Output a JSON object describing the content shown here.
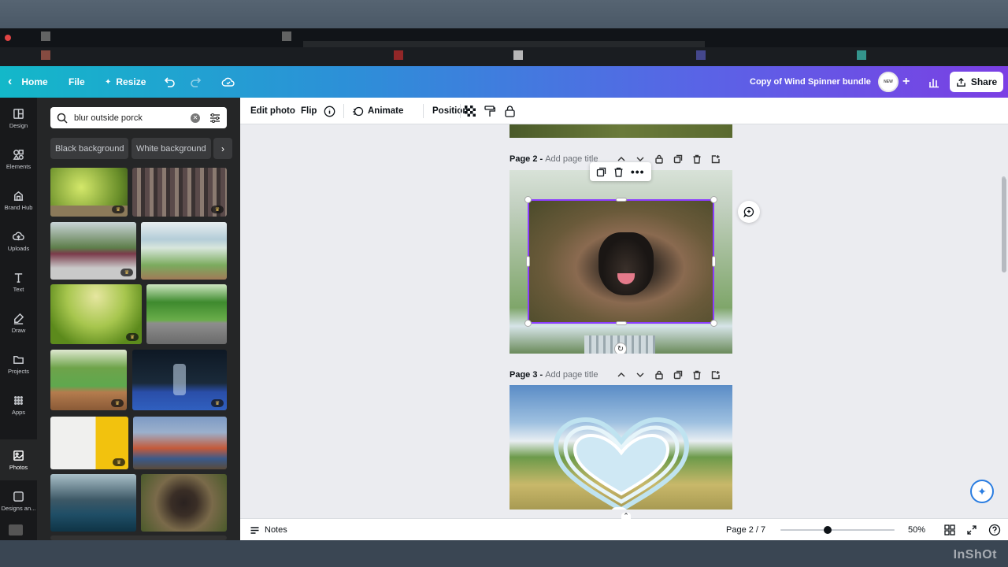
{
  "topbar": {
    "home": "Home",
    "file": "File",
    "resize": "Resize",
    "doc_title": "Copy of Wind Spinner bundle",
    "share": "Share"
  },
  "rail": [
    {
      "label": "Design",
      "icon": "design-icon"
    },
    {
      "label": "Elements",
      "icon": "elements-icon"
    },
    {
      "label": "Brand Hub",
      "icon": "brand-hub-icon"
    },
    {
      "label": "Uploads",
      "icon": "uploads-icon"
    },
    {
      "label": "Text",
      "icon": "text-icon"
    },
    {
      "label": "Draw",
      "icon": "draw-icon"
    },
    {
      "label": "Projects",
      "icon": "projects-icon"
    },
    {
      "label": "Apps",
      "icon": "apps-icon"
    },
    {
      "label": "Photos",
      "icon": "photos-icon"
    },
    {
      "label": "Designs an...",
      "icon": "designs-icon"
    }
  ],
  "search": {
    "value": "blur outside porck"
  },
  "chips": [
    "Black background",
    "White background"
  ],
  "context_bar": {
    "edit_photo": "Edit photo",
    "flip": "Flip",
    "animate": "Animate",
    "position": "Position"
  },
  "pages": [
    {
      "label": "Page 2 -",
      "placeholder": "Add page title"
    },
    {
      "label": "Page 3 -",
      "placeholder": "Add page title"
    }
  ],
  "bottombar": {
    "notes": "Notes",
    "page_indicator": "Page 2 / 7",
    "zoom": "50%"
  },
  "watermark": "InShOt",
  "colors": {
    "accent": "#7b3fe4",
    "teal": "#13b8c9"
  }
}
